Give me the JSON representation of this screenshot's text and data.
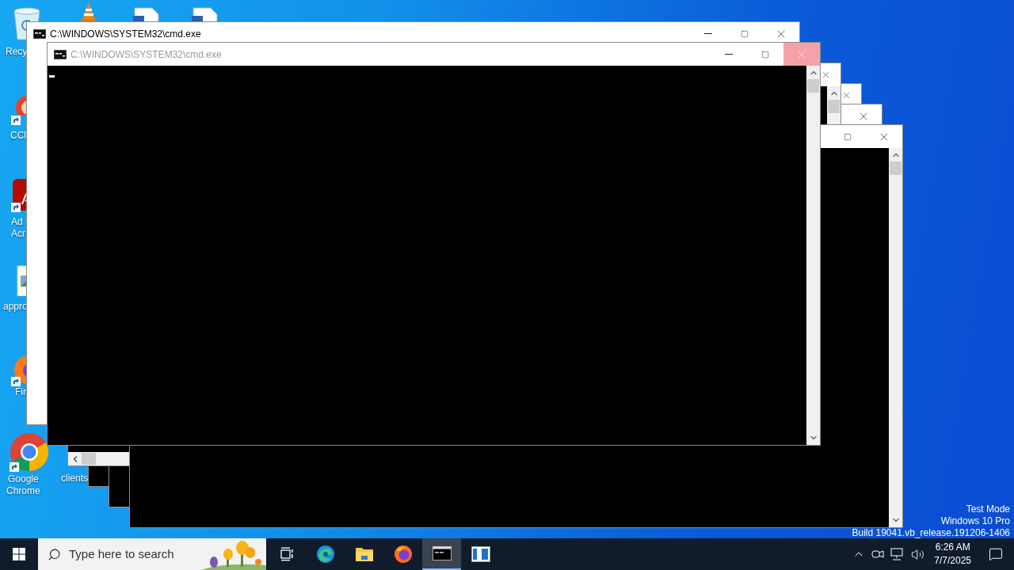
{
  "desktop": {
    "icons": [
      {
        "kind": "recycle-bin",
        "label": [
          "Recy"
        ]
      },
      {
        "kind": "cone"
      },
      {
        "kind": "document"
      },
      {
        "kind": "document"
      },
      {
        "kind": "ring",
        "shortcut": true,
        "label": [
          "CCl"
        ]
      },
      {
        "kind": "acrobat",
        "shortcut": true,
        "label": [
          "Ad",
          "Acr"
        ]
      },
      {
        "kind": "image-file",
        "label": [
          "appro"
        ]
      },
      {
        "kind": "firefox",
        "shortcut": true,
        "label": [
          "Fir"
        ]
      },
      {
        "kind": "chrome",
        "shortcut": true,
        "label": [
          "Google",
          "Chrome"
        ]
      },
      {
        "kind": "covered",
        "label": [
          "clients"
        ]
      }
    ],
    "edition": [
      "Test Mode",
      "Windows 10 Pro",
      "Build 19041.vb_release.191206-1406"
    ]
  },
  "windows": [
    {
      "title": "C:\\WINDOWS\\SYSTEM32\\cmd.exe",
      "active": true,
      "color": "#ffffff",
      "buttons": [
        {
          "kind": "minimize",
          "hovered": false
        },
        {
          "kind": "maximize",
          "hovered": false
        },
        {
          "kind": "close",
          "hovered": false
        }
      ]
    },
    {
      "title": "C:\\WINDOWS\\SYSTEM32\\cmd.exe",
      "active": false,
      "color": "#000000",
      "cursor": true,
      "vertical_scrollbar": true,
      "buttons": [
        {
          "kind": "minimize",
          "hovered": false
        },
        {
          "kind": "maximize",
          "hovered": false
        },
        {
          "kind": "close",
          "hovered": true
        }
      ]
    },
    {
      "color": "#000000",
      "vertical_scrollbar": true,
      "horizontal_scrollbar": true,
      "buttons": [
        {
          "kind": "close",
          "hovered": false
        }
      ]
    },
    {
      "color": "#000000",
      "buttons": [
        {
          "kind": "close",
          "hovered": false
        }
      ]
    },
    {
      "color": "#000000",
      "buttons": [
        {
          "kind": "close",
          "hovered": false
        }
      ]
    },
    {
      "color": "#000000",
      "vertical_scrollbar": true,
      "buttons": [
        {
          "kind": "maximize",
          "hovered": false
        },
        {
          "kind": "close",
          "hovered": false
        }
      ]
    }
  ],
  "taskbar": {
    "search": {
      "placeholder": "Type here to search"
    },
    "apps": [
      {
        "kind": "task-view",
        "active": false
      },
      {
        "kind": "edge",
        "active": false
      },
      {
        "kind": "folder",
        "active": false
      },
      {
        "kind": "firefox",
        "active": false
      },
      {
        "kind": "console",
        "active": true
      },
      {
        "kind": "app-window",
        "active": false
      }
    ],
    "tray": {
      "time": "6:26 AM",
      "date": "7/7/2025"
    }
  }
}
